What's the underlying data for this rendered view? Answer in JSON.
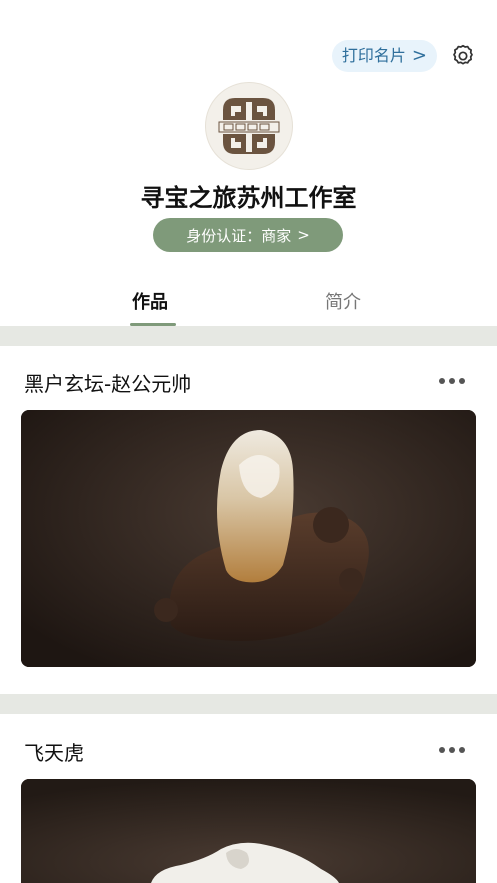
{
  "header": {
    "print_card_label": "打印名片",
    "print_card_chevron": ">"
  },
  "profile": {
    "name": "寻宝之旅苏州工作室",
    "identity_label": "身份认证：商家",
    "identity_chevron": ">"
  },
  "tabs": [
    {
      "label": "作品",
      "active": true
    },
    {
      "label": "简介",
      "active": false
    }
  ],
  "posts": [
    {
      "title": "黑户玄坛-赵公元帅",
      "image": "jade-sculpture-on-wood-stand"
    },
    {
      "title": "飞天虎",
      "image": "white-jade-tiger"
    }
  ],
  "icons": {
    "settings": "gear-icon",
    "more": "more-icon",
    "avatar_logo": "logo-emblem"
  },
  "colors": {
    "accent": "#7f9a7a",
    "print_bg": "#e8f3fb",
    "print_text": "#2f6f9c",
    "logo_brown": "#6b5440",
    "band": "#e6e8e3"
  }
}
